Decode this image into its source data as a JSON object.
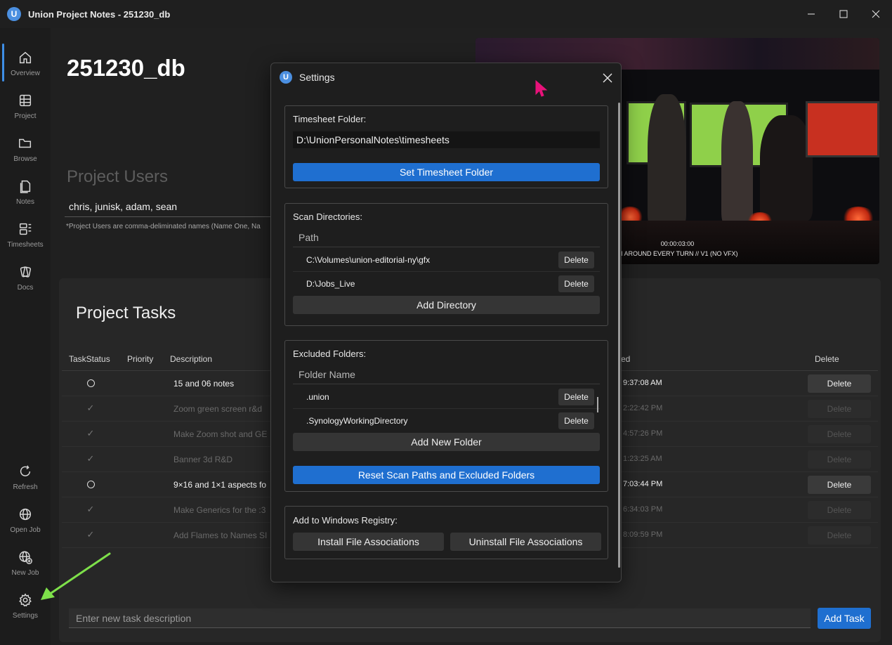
{
  "window": {
    "title": "Union Project Notes - 251230_db",
    "logo_letter": "U",
    "minimize": "—",
    "maximize": "☐",
    "close": "✕"
  },
  "sidebar": {
    "top_items": [
      {
        "label": "Overview",
        "icon": "home-icon"
      },
      {
        "label": "Project",
        "icon": "grid-icon"
      },
      {
        "label": "Browse",
        "icon": "folder-icon"
      },
      {
        "label": "Notes",
        "icon": "notes-icon"
      },
      {
        "label": "Timesheets",
        "icon": "timesheet-icon"
      },
      {
        "label": "Docs",
        "icon": "docs-icon"
      }
    ],
    "bottom_items": [
      {
        "label": "Refresh",
        "icon": "refresh-icon"
      },
      {
        "label": "Open Job",
        "icon": "globe-icon"
      },
      {
        "label": "New Job",
        "icon": "globe-plus-icon"
      },
      {
        "label": "Settings",
        "icon": "gear-icon"
      }
    ]
  },
  "project": {
    "title": "251230_db",
    "users_heading": "Project Users",
    "users_value": "chris, junisk, adam, sean",
    "users_note": "*Project Users are comma-deliminated names (Name One, Na"
  },
  "video": {
    "timecode": "00:00:03:00",
    "caption": "N AROUND EVERY TURN // V1 (NO VFX)"
  },
  "tasks": {
    "heading": "Project Tasks",
    "columns": {
      "status": "TaskStatus",
      "priority": "Priority",
      "description": "Description",
      "completed": "ed",
      "delete": "Delete"
    },
    "rows": [
      {
        "done": false,
        "description": "15 and 06 notes",
        "time": "9:37:08 AM",
        "delete": "Delete"
      },
      {
        "done": true,
        "description": "Zoom green screen r&d",
        "time": "2:22:42 PM",
        "delete": "Delete"
      },
      {
        "done": true,
        "description": "Make Zoom shot and GE",
        "time": "4:57:26 PM",
        "delete": "Delete"
      },
      {
        "done": true,
        "description": "Banner 3d R&D",
        "time": "1:23:25 AM",
        "delete": "Delete"
      },
      {
        "done": false,
        "description": "9×16 and 1×1 aspects fo",
        "time": "7:03:44 PM",
        "delete": "Delete"
      },
      {
        "done": true,
        "description": "Make Generics for the :3",
        "time": "6:34:03 PM",
        "delete": "Delete"
      },
      {
        "done": true,
        "description": "Add Flames to Names SI",
        "time": "8:09:59 PM",
        "delete": "Delete"
      }
    ],
    "new_task_placeholder": "Enter new task description",
    "add_task_label": "Add Task"
  },
  "settings_dialog": {
    "title": "Settings",
    "logo_letter": "U",
    "close": "✕",
    "timesheet": {
      "label": "Timesheet Folder:",
      "path": "D:\\UnionPersonalNotes\\timesheets",
      "button": "Set Timesheet Folder"
    },
    "scan": {
      "label": "Scan Directories:",
      "column": "Path",
      "rows": [
        {
          "path": "C:\\Volumes\\union-editorial-ny\\gfx",
          "delete": "Delete"
        },
        {
          "path": "D:\\Jobs_Live",
          "delete": "Delete"
        }
      ],
      "add_button": "Add Directory"
    },
    "excluded": {
      "label": "Excluded Folders:",
      "column": "Folder Name",
      "rows": [
        {
          "name": ".union",
          "delete": "Delete"
        },
        {
          "name": ".SynologyWorkingDirectory",
          "delete": "Delete"
        }
      ],
      "add_button": "Add New Folder",
      "reset_button": "Reset Scan Paths and Excluded Folders"
    },
    "registry": {
      "label": "Add to Windows Registry:",
      "install": "Install File Associations",
      "uninstall": "Uninstall File Associations"
    }
  },
  "colors": {
    "accent": "#1f6fd0",
    "active_nav": "#3e8ee6",
    "arrow": "#7ee04a",
    "cursor": "#e8127a"
  }
}
